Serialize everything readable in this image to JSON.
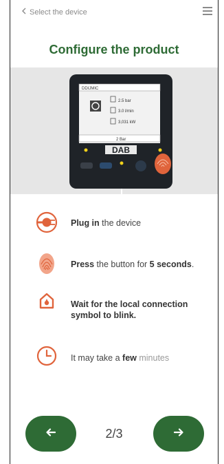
{
  "topbar": {
    "back_label": "Select the device",
    "back_icon": "chevron-left-icon",
    "menu_icon": "hamburger-menu-icon"
  },
  "title": "Configure the product",
  "device": {
    "brand": "DAB",
    "screen_header": "DDIJMIC",
    "screen_lines": [
      "2.5 bar",
      "3.0 l/min",
      "3,031 kW"
    ],
    "screen_footer": "2 Bar"
  },
  "steps": [
    {
      "icon": "plug-icon",
      "bold": "Plug in",
      "text": " the device",
      "bold2": "",
      "text2": ""
    },
    {
      "icon": "fingerprint-icon",
      "bold": "Press",
      "text": " the button for ",
      "bold2": "5 seconds",
      "text2": "."
    },
    {
      "icon": "home-icon",
      "bold": "Wait for the local connection symbol to blink.",
      "text": "",
      "bold2": "",
      "text2": ""
    },
    {
      "icon": "clock-icon",
      "bold": "",
      "text": "It may take a ",
      "bold2": "few",
      "text2": " minutes"
    }
  ],
  "nav": {
    "prev_icon": "arrow-left-icon",
    "next_icon": "arrow-right-icon",
    "page": "2/3"
  },
  "colors": {
    "accent_green": "#2e6b35",
    "icon_orange": "#e0643c",
    "device_body": "#1f2328"
  }
}
